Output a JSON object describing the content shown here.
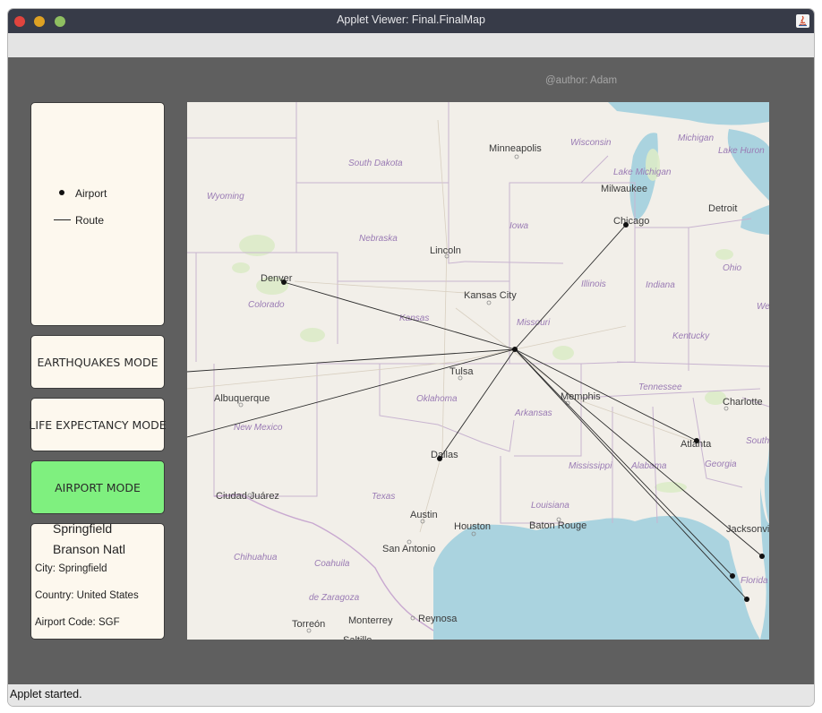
{
  "window": {
    "title": "Applet Viewer: Final.FinalMap"
  },
  "canvas": {
    "author": "@author: Adam"
  },
  "legend": {
    "airport_label": "Airport",
    "route_label": "Route"
  },
  "modes": {
    "earthquakes": "EARTHQUAKES MODE",
    "life_expectancy": "LIFE EXPECTANCY MODE",
    "airport": "AIRPORT MODE",
    "active": "airport",
    "active_color": "#7ff07f"
  },
  "info": {
    "title_line1": "Springfield",
    "title_line2": "Branson Natl",
    "city": "City: Springfield",
    "country": "Country: United States",
    "code": "Airport Code: SGF"
  },
  "map": {
    "states": [
      "South Dakota",
      "Wisconsin",
      "Michigan",
      "Lake Huron",
      "Lake Michigan",
      "Wyoming",
      "Iowa",
      "Nebraska",
      "Ohio",
      "Illinois",
      "Indiana",
      "Colorado",
      "Kansas",
      "Missouri",
      "Kentucky",
      "Tennessee",
      "Oklahoma",
      "Arkansas",
      "New Mexico",
      "South",
      "Georgia",
      "Mississippi",
      "Alabama",
      "Texas",
      "Louisiana",
      "Florida",
      "Chihuahua",
      "Coahuila de Zaragoza",
      "We"
    ],
    "cities": [
      "Minneapolis",
      "Milwaukee",
      "Chicago",
      "Detroit",
      "Lincoln",
      "Denver",
      "Kansas City",
      "Tulsa",
      "Memphis",
      "Charlotte",
      "Albuquerque",
      "Atlanta",
      "Dallas",
      "Ciudad Juárez",
      "Austin",
      "Houston",
      "Baton Rouge",
      "Jacksonvi",
      "San Antonio",
      "Torreón",
      "Monterrey",
      "Reynosa",
      "Saltillo"
    ],
    "hub": "Springfield",
    "route_destinations": [
      "Denver",
      "Chicago",
      "Dallas",
      "Atlanta",
      "Jacksonville",
      "Tampa",
      "Fort Myers",
      "West (off map)",
      "Southwest (off map)"
    ]
  },
  "status": {
    "text": "Applet started."
  },
  "colors": {
    "water": "#aad3df",
    "land": "#f2efe9",
    "border": "#c8b4d0",
    "panel": "#fdf8ee",
    "background": "#5f5f5f"
  }
}
